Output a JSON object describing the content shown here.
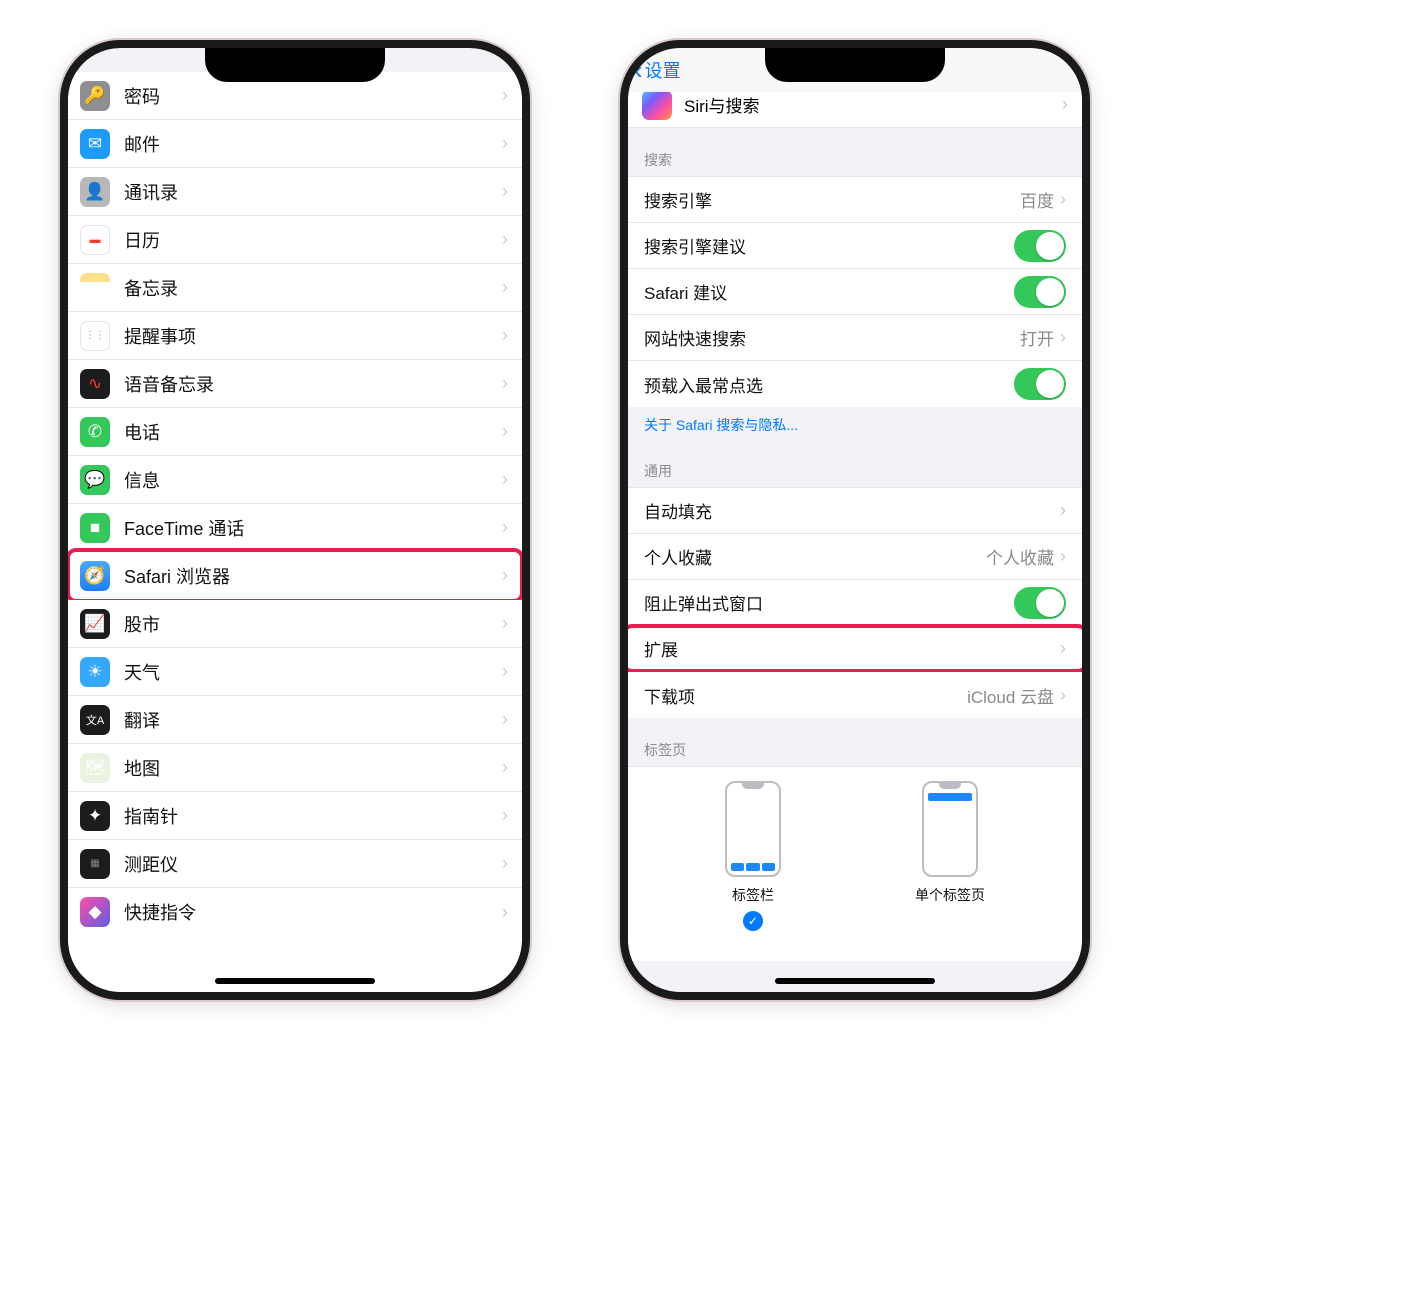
{
  "left_phone": {
    "items": [
      {
        "label": "密码",
        "icon": "key-icon"
      },
      {
        "label": "邮件",
        "icon": "mail-icon"
      },
      {
        "label": "通讯录",
        "icon": "contacts-icon"
      },
      {
        "label": "日历",
        "icon": "calendar-icon"
      },
      {
        "label": "备忘录",
        "icon": "notes-icon"
      },
      {
        "label": "提醒事项",
        "icon": "reminders-icon"
      },
      {
        "label": "语音备忘录",
        "icon": "voicememo-icon"
      },
      {
        "label": "电话",
        "icon": "phone-icon"
      },
      {
        "label": "信息",
        "icon": "messages-icon"
      },
      {
        "label": "FaceTime 通话",
        "icon": "facetime-icon"
      },
      {
        "label": "Safari 浏览器",
        "icon": "safari-icon",
        "highlighted": true
      },
      {
        "label": "股市",
        "icon": "stocks-icon"
      },
      {
        "label": "天气",
        "icon": "weather-icon"
      },
      {
        "label": "翻译",
        "icon": "translate-icon"
      },
      {
        "label": "地图",
        "icon": "maps-icon"
      },
      {
        "label": "指南针",
        "icon": "compass-icon"
      },
      {
        "label": "测距仪",
        "icon": "measure-icon"
      },
      {
        "label": "快捷指令",
        "icon": "shortcuts-icon"
      }
    ]
  },
  "right_phone": {
    "back_label": "设置",
    "siri_label": "Siri与搜索",
    "section_search": "搜索",
    "search_rows": {
      "engine": {
        "label": "搜索引擎",
        "value": "百度"
      },
      "engine_suggest": {
        "label": "搜索引擎建议"
      },
      "safari_suggest": {
        "label": "Safari 建议"
      },
      "quick_site": {
        "label": "网站快速搜索",
        "value": "打开"
      },
      "preload": {
        "label": "预载入最常点选"
      }
    },
    "search_footer": "关于 Safari 搜索与隐私...",
    "section_general": "通用",
    "general_rows": {
      "autofill": {
        "label": "自动填充"
      },
      "favorites": {
        "label": "个人收藏",
        "value": "个人收藏"
      },
      "block_popup": {
        "label": "阻止弹出式窗口"
      },
      "extensions": {
        "label": "扩展",
        "highlighted": true
      },
      "downloads": {
        "label": "下载项",
        "value": "iCloud 云盘"
      }
    },
    "section_tabs": "标签页",
    "tab_options": {
      "tab_bar": "标签栏",
      "single_tab": "单个标签页"
    }
  }
}
